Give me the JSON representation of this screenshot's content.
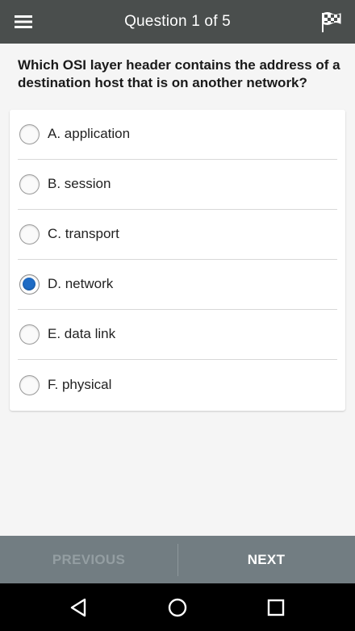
{
  "appbar": {
    "title": "Question 1 of 5",
    "menu_icon": "hamburger-menu-icon",
    "flag_icon": "checkered-flag-icon"
  },
  "question": {
    "text": "Which OSI layer header contains the address of a destination host that is on another network?"
  },
  "options": [
    {
      "label": "A. application",
      "selected": false
    },
    {
      "label": "B. session",
      "selected": false
    },
    {
      "label": "C. transport",
      "selected": false
    },
    {
      "label": "D. network",
      "selected": true
    },
    {
      "label": "E. data link",
      "selected": false
    },
    {
      "label": "F. physical",
      "selected": false
    }
  ],
  "footer": {
    "previous_label": "PREVIOUS",
    "next_label": "NEXT"
  },
  "system_nav": {
    "back_icon": "back-triangle-icon",
    "home_icon": "home-circle-icon",
    "recents_icon": "recents-square-icon"
  },
  "colors": {
    "appbar": "#4a4e4d",
    "accent_radio": "#1e6bc4",
    "bottom_bar": "#727d82",
    "disabled_text": "#949ea2"
  }
}
